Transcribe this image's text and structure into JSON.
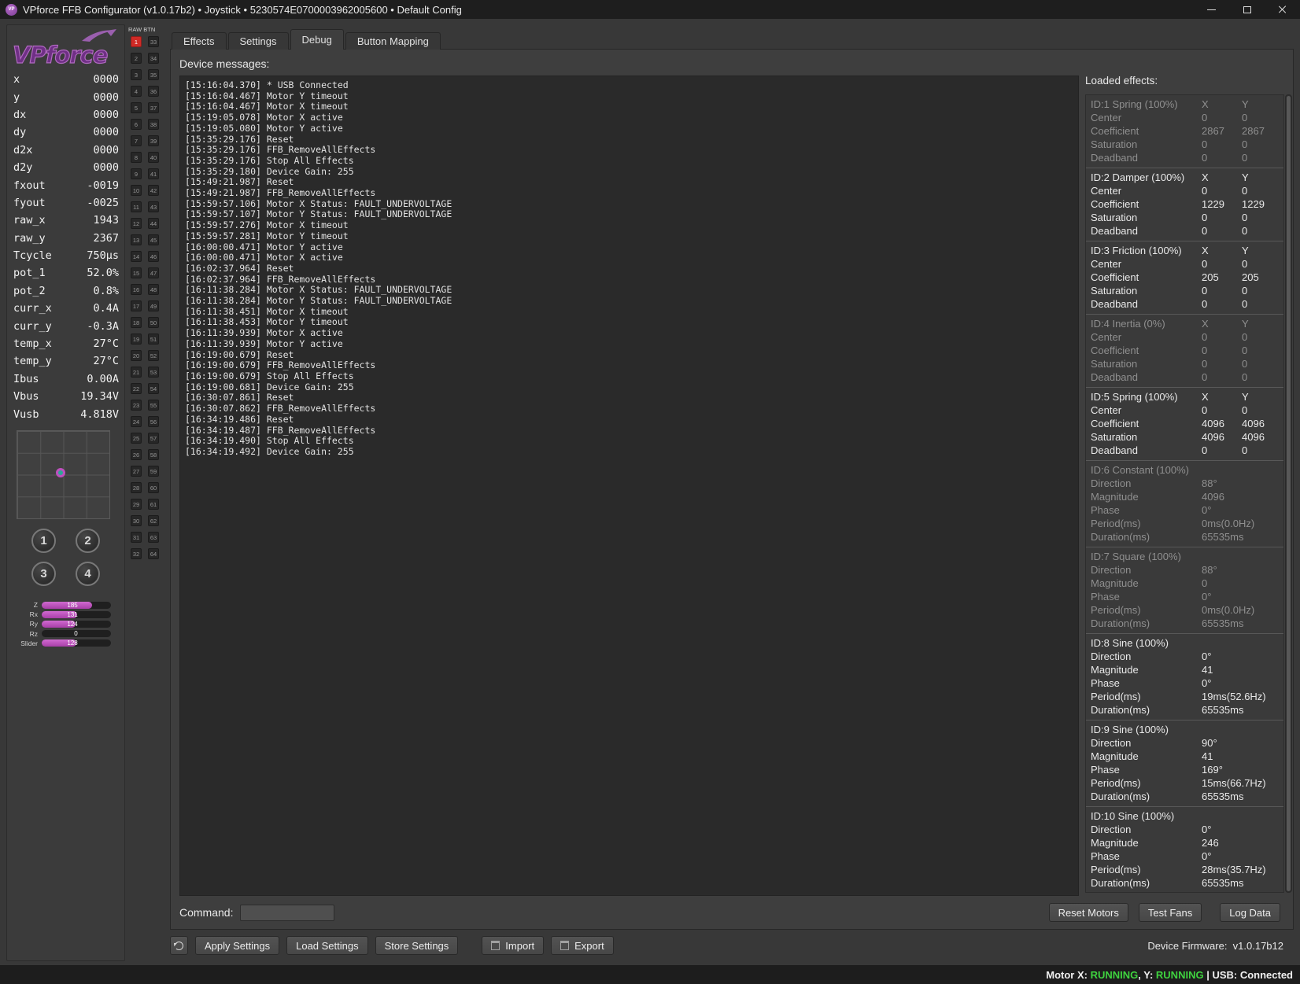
{
  "titlebar": {
    "title": "VPforce FFB Configurator (v1.0.17b2) • Joystick • 5230574E0700003962005600 • Default Config",
    "app_monogram": "VP"
  },
  "sidebar": {
    "logo_text": "VPforce",
    "telemetry": [
      {
        "label": "x",
        "value": "0000"
      },
      {
        "label": "y",
        "value": "0000"
      },
      {
        "label": "dx",
        "value": "0000"
      },
      {
        "label": "dy",
        "value": "0000"
      },
      {
        "label": "d2x",
        "value": "0000"
      },
      {
        "label": "d2y",
        "value": "0000"
      },
      {
        "label": "fxout",
        "value": "-0019"
      },
      {
        "label": "fyout",
        "value": "-0025"
      },
      {
        "label": "raw_x",
        "value": "1943"
      },
      {
        "label": "raw_y",
        "value": "2367"
      },
      {
        "label": "Tcycle",
        "value": "750µs"
      },
      {
        "label": "pot_1",
        "value": "52.0%"
      },
      {
        "label": "pot_2",
        "value": "0.8%"
      },
      {
        "label": "curr_x",
        "value": "0.4A"
      },
      {
        "label": "curr_y",
        "value": "-0.3A"
      },
      {
        "label": "temp_x",
        "value": "27°C"
      },
      {
        "label": "temp_y",
        "value": "27°C"
      },
      {
        "label": "Ibus",
        "value": "0.00A"
      },
      {
        "label": "Vbus",
        "value": "19.34V"
      },
      {
        "label": "Vusb",
        "value": "4.818V"
      }
    ],
    "xy_indicator": {
      "x_pct": 47,
      "y_pct": 48
    },
    "buttons": [
      "1",
      "2",
      "3",
      "4"
    ],
    "axes": [
      {
        "label": "Z",
        "value": 185,
        "max": 255
      },
      {
        "label": "Rx",
        "value": 131,
        "max": 255
      },
      {
        "label": "Ry",
        "value": 124,
        "max": 255
      },
      {
        "label": "Rz",
        "value": 0,
        "max": 255
      },
      {
        "label": "Slider",
        "value": 128,
        "max": 255
      }
    ]
  },
  "raw_btn": {
    "header": "RAW BTN",
    "rows": 32,
    "first": 1,
    "last": 64,
    "active": [
      1
    ]
  },
  "tabs": [
    {
      "label": "Effects",
      "active": false
    },
    {
      "label": "Settings",
      "active": false
    },
    {
      "label": "Debug",
      "active": true
    },
    {
      "label": "Button Mapping",
      "active": false
    }
  ],
  "debug_tab": {
    "messages_label": "Device messages:",
    "command_label": "Command:",
    "command_value": "",
    "log": [
      "[15:16:04.370] * USB Connected",
      "[15:16:04.467] Motor Y timeout",
      "[15:16:04.467] Motor X timeout",
      "[15:19:05.078] Motor X active",
      "[15:19:05.080] Motor Y active",
      "[15:35:29.176] Reset",
      "[15:35:29.176] FFB_RemoveAllEffects",
      "[15:35:29.176] Stop All Effects",
      "[15:35:29.180] Device Gain: 255",
      "[15:49:21.987] Reset",
      "[15:49:21.987] FFB_RemoveAllEffects",
      "[15:59:57.106] Motor X Status: FAULT_UNDERVOLTAGE",
      "[15:59:57.107] Motor Y Status: FAULT_UNDERVOLTAGE",
      "[15:59:57.276] Motor X timeout",
      "[15:59:57.281] Motor Y timeout",
      "[16:00:00.471] Motor Y active",
      "[16:00:00.471] Motor X active",
      "[16:02:37.964] Reset",
      "[16:02:37.964] FFB_RemoveAllEffects",
      "[16:11:38.284] Motor X Status: FAULT_UNDERVOLTAGE",
      "[16:11:38.284] Motor Y Status: FAULT_UNDERVOLTAGE",
      "[16:11:38.451] Motor X timeout",
      "[16:11:38.453] Motor Y timeout",
      "[16:11:39.939] Motor X active",
      "[16:11:39.939] Motor Y active",
      "[16:19:00.679] Reset",
      "[16:19:00.679] FFB_RemoveAllEffects",
      "[16:19:00.679] Stop All Effects",
      "[16:19:00.681] Device Gain: 255",
      "[16:30:07.861] Reset",
      "[16:30:07.862] FFB_RemoveAllEffects",
      "[16:34:19.486] Reset",
      "[16:34:19.487] FFB_RemoveAllEffects",
      "[16:34:19.490] Stop All Effects",
      "[16:34:19.492] Device Gain: 255"
    ]
  },
  "effects": {
    "title": "Loaded effects:",
    "col_x": "X",
    "col_y": "Y",
    "items": [
      {
        "title": "ID:1 Spring (100%)",
        "enabled": false,
        "kind": "xy",
        "rows": [
          [
            "Center",
            "0",
            "0"
          ],
          [
            "Coefficient",
            "2867",
            "2867"
          ],
          [
            "Saturation",
            "0",
            "0"
          ],
          [
            "Deadband",
            "0",
            "0"
          ]
        ]
      },
      {
        "title": "ID:2 Damper (100%)",
        "enabled": true,
        "kind": "xy",
        "rows": [
          [
            "Center",
            "0",
            "0"
          ],
          [
            "Coefficient",
            "1229",
            "1229"
          ],
          [
            "Saturation",
            "0",
            "0"
          ],
          [
            "Deadband",
            "0",
            "0"
          ]
        ]
      },
      {
        "title": "ID:3 Friction (100%)",
        "enabled": true,
        "kind": "xy",
        "rows": [
          [
            "Center",
            "0",
            "0"
          ],
          [
            "Coefficient",
            "205",
            "205"
          ],
          [
            "Saturation",
            "0",
            "0"
          ],
          [
            "Deadband",
            "0",
            "0"
          ]
        ]
      },
      {
        "title": "ID:4 Inertia (0%)",
        "enabled": false,
        "kind": "xy",
        "rows": [
          [
            "Center",
            "0",
            "0"
          ],
          [
            "Coefficient",
            "0",
            "0"
          ],
          [
            "Saturation",
            "0",
            "0"
          ],
          [
            "Deadband",
            "0",
            "0"
          ]
        ]
      },
      {
        "title": "ID:5 Spring (100%)",
        "enabled": true,
        "kind": "xy",
        "rows": [
          [
            "Center",
            "0",
            "0"
          ],
          [
            "Coefficient",
            "4096",
            "4096"
          ],
          [
            "Saturation",
            "4096",
            "4096"
          ],
          [
            "Deadband",
            "0",
            "0"
          ]
        ]
      },
      {
        "title": "ID:6 Constant (100%)",
        "enabled": false,
        "kind": "periodic",
        "rows": [
          [
            "Direction",
            "88°"
          ],
          [
            "Magnitude",
            "4096"
          ],
          [
            "Phase",
            "0°"
          ],
          [
            "Period(ms)",
            "0ms(0.0Hz)"
          ],
          [
            "Duration(ms)",
            "65535ms"
          ]
        ]
      },
      {
        "title": "ID:7 Square (100%)",
        "enabled": false,
        "kind": "periodic",
        "rows": [
          [
            "Direction",
            "88°"
          ],
          [
            "Magnitude",
            "0"
          ],
          [
            "Phase",
            "0°"
          ],
          [
            "Period(ms)",
            "0ms(0.0Hz)"
          ],
          [
            "Duration(ms)",
            "65535ms"
          ]
        ]
      },
      {
        "title": "ID:8 Sine (100%)",
        "enabled": true,
        "kind": "periodic",
        "rows": [
          [
            "Direction",
            "0°"
          ],
          [
            "Magnitude",
            "41"
          ],
          [
            "Phase",
            "0°"
          ],
          [
            "Period(ms)",
            "19ms(52.6Hz)"
          ],
          [
            "Duration(ms)",
            "65535ms"
          ]
        ]
      },
      {
        "title": "ID:9 Sine (100%)",
        "enabled": true,
        "kind": "periodic",
        "rows": [
          [
            "Direction",
            "90°"
          ],
          [
            "Magnitude",
            "41"
          ],
          [
            "Phase",
            "169°"
          ],
          [
            "Period(ms)",
            "15ms(66.7Hz)"
          ],
          [
            "Duration(ms)",
            "65535ms"
          ]
        ]
      },
      {
        "title": "ID:10 Sine (100%)",
        "enabled": true,
        "kind": "periodic",
        "rows": [
          [
            "Direction",
            "0°"
          ],
          [
            "Magnitude",
            "246"
          ],
          [
            "Phase",
            "0°"
          ],
          [
            "Period(ms)",
            "28ms(35.7Hz)"
          ],
          [
            "Duration(ms)",
            "65535ms"
          ]
        ]
      }
    ]
  },
  "footer": {
    "reset_motors": "Reset Motors",
    "test_fans": "Test Fans",
    "log_data": "Log Data",
    "apply_settings": "Apply Settings",
    "load_settings": "Load Settings",
    "store_settings": "Store Settings",
    "import": "Import",
    "export": "Export",
    "firmware": "Device Firmware:  v1.0.17b12"
  },
  "statusbar": {
    "motor_x_label": "Motor X: ",
    "motor_x_status": "RUNNING",
    "y_label": ", Y: ",
    "motor_y_status": "RUNNING",
    "usb_label": " | USB: ",
    "usb_status": "Connected"
  },
  "colors": {
    "accent_magenta": "#b84fb8",
    "running_green": "#3fd23f",
    "active_button_red": "#d02a26"
  }
}
